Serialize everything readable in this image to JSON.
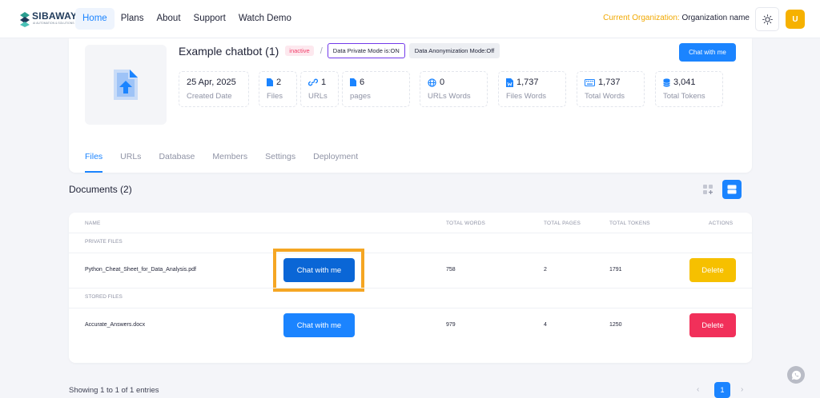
{
  "brand": {
    "name": "SIBAWAY",
    "tagline": "AI AUTOMATION & SOLUTIONS"
  },
  "nav": {
    "items": [
      "Home",
      "Plans",
      "About",
      "Support",
      "Watch Demo"
    ],
    "active": "Home"
  },
  "org": {
    "label": "Current Organization:",
    "name": "Organization name"
  },
  "user": {
    "initial": "U"
  },
  "bot": {
    "title": "Example chatbot (1)",
    "status": "inactive",
    "separator": "/",
    "private_mode": "Data Private Mode is:ON",
    "anonymization": "Data Anonymization Mode:Off",
    "chat_button": "Chat with me"
  },
  "stats": [
    {
      "icon": "",
      "value": "25 Apr, 2025",
      "label": "Created Date"
    },
    {
      "icon": "file-icon",
      "value": "2",
      "label": "Files"
    },
    {
      "icon": "link-icon",
      "value": "1",
      "label": "URLs"
    },
    {
      "icon": "file-icon",
      "value": "6",
      "label": "pages"
    },
    {
      "icon": "globe-icon",
      "value": "0",
      "label": "URLs Words"
    },
    {
      "icon": "word-file-icon",
      "value": "1,737",
      "label": "Files Words"
    },
    {
      "icon": "keyboard-icon",
      "value": "1,737",
      "label": "Total Words"
    },
    {
      "icon": "database-icon",
      "value": "3,041",
      "label": "Total Tokens"
    }
  ],
  "tabs": [
    "Files",
    "URLs",
    "Database",
    "Members",
    "Settings",
    "Deployment"
  ],
  "active_tab": "Files",
  "documents": {
    "title": "Documents (2)",
    "columns": [
      "NAME",
      "TOTAL WORDS",
      "TOTAL PAGES",
      "TOTAL TOKENS",
      "ACTIONS"
    ],
    "sections": [
      {
        "label": "PRIVATE FILES",
        "rows": [
          {
            "name": "Python_Cheat_Sheet_for_Data_Analysis.pdf",
            "chat": "Chat with me",
            "words": "758",
            "pages": "2",
            "tokens": "1791",
            "action": "Delete"
          }
        ]
      },
      {
        "label": "STORED FILES",
        "rows": [
          {
            "name": "Accurate_Answers.docx",
            "chat": "Chat with me",
            "words": "979",
            "pages": "4",
            "tokens": "1250",
            "action": "Delete"
          }
        ]
      }
    ]
  },
  "footer": {
    "showing": "Showing 1 to 1 of 1 entries",
    "page": "1",
    "prev": "‹",
    "next": "›"
  },
  "colors": {
    "primary": "#1b84ff",
    "warning": "#f6c000",
    "danger": "#f1305a",
    "highlight": "#f5a623"
  }
}
